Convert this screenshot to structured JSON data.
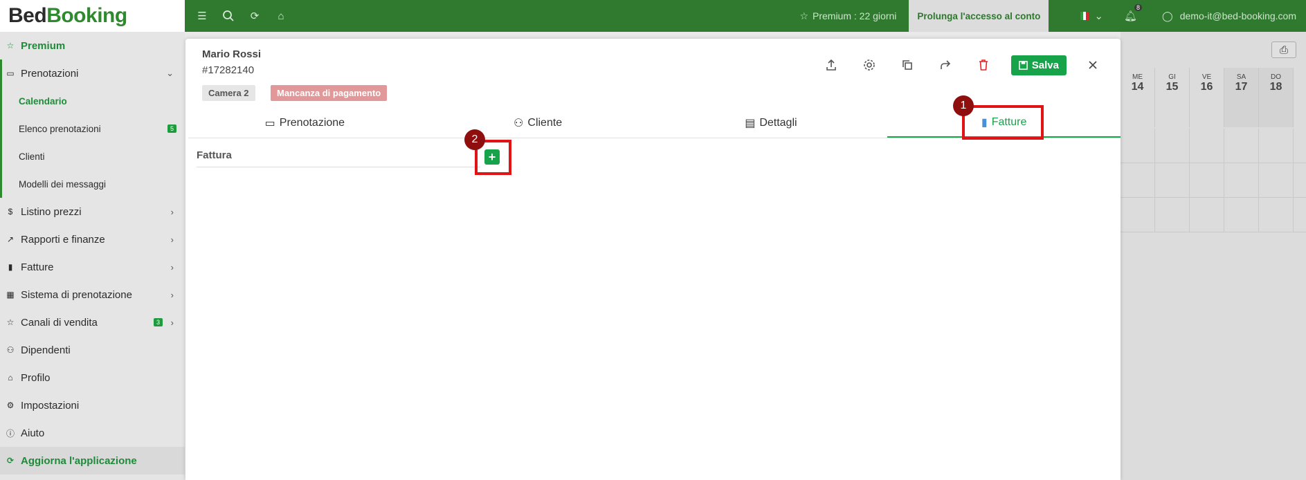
{
  "sidebar": {
    "logo_bed": "Bed",
    "logo_booking": "Booking",
    "premium": "Premium",
    "groups": {
      "prenotazioni": "Prenotazioni",
      "listino": "Listino prezzi",
      "rapporti": "Rapporti e finanze",
      "fatture": "Fatture",
      "sistema": "Sistema di prenotazione",
      "canali": "Canali di vendita",
      "dipendenti": "Dipendenti",
      "profilo": "Profilo",
      "impostazioni": "Impostazioni",
      "aiuto": "Aiuto",
      "aggiorna": "Aggiorna l'applicazione"
    },
    "sub": {
      "calendario": "Calendario",
      "elenco": "Elenco prenotazioni",
      "clienti": "Clienti",
      "modelli": "Modelli dei messaggi"
    },
    "badges": {
      "elenco": "5",
      "canali": "3"
    }
  },
  "topbar": {
    "premium": "Premium : 22 giorni",
    "prolunga": "Prolunga l'accesso al conto",
    "notifications": "8",
    "user_email": "demo-it@bed-booking.com"
  },
  "calendar": {
    "days": [
      {
        "wd": "ME",
        "d": "14"
      },
      {
        "wd": "GI",
        "d": "15"
      },
      {
        "wd": "VE",
        "d": "16"
      },
      {
        "wd": "SA",
        "d": "17"
      },
      {
        "wd": "DO",
        "d": "18"
      }
    ]
  },
  "modal": {
    "guest_name": "Mario Rossi",
    "booking_number": "#17282140",
    "room_chip": "Camera 2",
    "status_chip": "Mancanza di pagamento",
    "save_label": "Salva",
    "tabs": {
      "prenotazione": "Prenotazione",
      "cliente": "Cliente",
      "dettagli": "Dettagli",
      "fatture": "Fatture"
    },
    "section_label": "Fattura",
    "add_label": "+"
  },
  "annotations": {
    "m1": "1",
    "m2": "2"
  },
  "colors": {
    "brand_green": "#2f7a2f",
    "accent_green": "#16a34a",
    "danger": "#e32525",
    "highlight_red": "#e01414",
    "marker": "#8f0f0f"
  }
}
